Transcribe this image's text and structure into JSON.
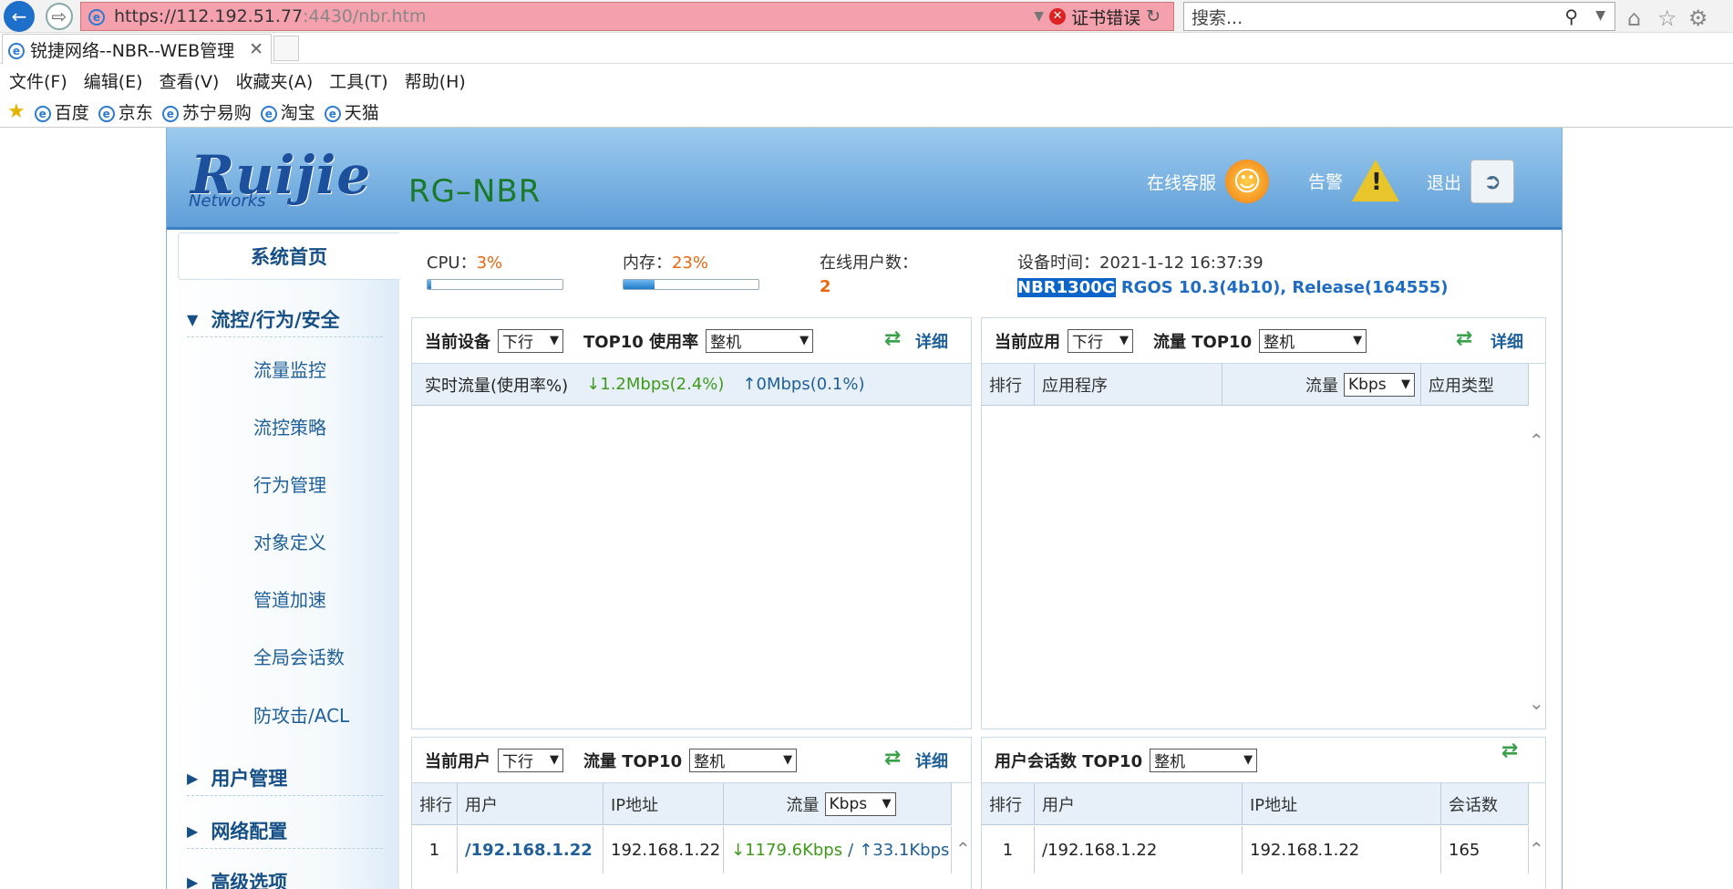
{
  "browser": {
    "url_main": "https://112.192.51.77",
    "url_port": ":4430/nbr.htm",
    "cert_error": "证书错误",
    "search_placeholder": "搜索...",
    "tab_title": "锐捷网络--NBR--WEB管理",
    "menu": [
      "文件(F)",
      "编辑(E)",
      "查看(V)",
      "收藏夹(A)",
      "工具(T)",
      "帮助(H)"
    ],
    "favorites": [
      "百度",
      "京东",
      "苏宁易购",
      "淘宝",
      "天猫"
    ]
  },
  "header": {
    "logo": "Ruijie",
    "logo_sub": "Networks",
    "model": "RG–NBR",
    "online_service": "在线客服",
    "alarm": "告警",
    "logout": "退出"
  },
  "sidebar": {
    "home": "系统首页",
    "group_flow": "流控/行为/安全",
    "sub_items": [
      "流量监控",
      "流控策略",
      "行为管理",
      "对象定义",
      "管道加速",
      "全局会话数",
      "防攻击/ACL"
    ],
    "group_user": "用户管理",
    "group_network": "网络配置",
    "group_advanced": "高级选项"
  },
  "status": {
    "cpu_label": "CPU：",
    "cpu_value": "3%",
    "cpu_fraction": 0.03,
    "mem_label": "内存：",
    "mem_value": "23%",
    "mem_fraction": 0.23,
    "online_label": "在线用户数：",
    "online_value": "2",
    "time_label": "设备时间：",
    "time_value": "2021-1-12 16:37:39",
    "device_model": "NBR1300G",
    "device_version": "RGOS 10.3(4b10), Release(164555)"
  },
  "panel_device": {
    "title": "当前设备",
    "dir": "下行",
    "top10": "TOP10 使用率",
    "scope": "整机",
    "detail": "详细",
    "realtime_label": "实时流量(使用率%)",
    "down": "↓1.2Mbps(2.4%)",
    "up": "↑0Mbps(0.1%)"
  },
  "panel_app": {
    "title": "当前应用",
    "dir": "下行",
    "top10": "流量 TOP10",
    "scope": "整机",
    "detail": "详细",
    "col_rank": "排行",
    "col_app": "应用程序",
    "col_flow": "流量",
    "unit": "Kbps",
    "col_type": "应用类型"
  },
  "panel_user": {
    "title": "当前用户",
    "dir": "下行",
    "top10": "流量 TOP10",
    "scope": "整机",
    "detail": "详细",
    "col_rank": "排行",
    "col_user": "用户",
    "col_ip": "IP地址",
    "col_flow": "流量",
    "unit": "Kbps",
    "row1_rank": "1",
    "row1_user": "/192.168.1.22",
    "row1_ip": "192.168.1.22",
    "row1_down": "↓1179.6Kbps",
    "row1_sep": "/",
    "row1_up": "↑33.1Kbps"
  },
  "panel_session": {
    "title": "用户会话数 TOP10",
    "scope": "整机",
    "col_rank": "排行",
    "col_user": "用户",
    "col_ip": "IP地址",
    "col_count": "会话数",
    "row1_rank": "1",
    "row1_user": "/192.168.1.22",
    "row1_ip": "192.168.1.22",
    "row1_count": "165"
  }
}
